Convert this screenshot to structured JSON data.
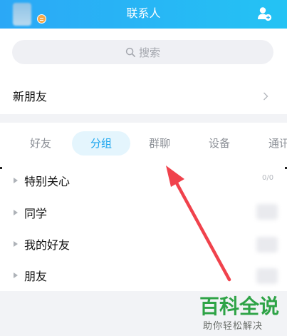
{
  "header": {
    "title": "联系人",
    "add_contact_icon": "add-contact-icon"
  },
  "search": {
    "placeholder": "搜索",
    "icon": "search-icon"
  },
  "new_friend": {
    "label": "新朋友",
    "icon": "chevron-right-icon"
  },
  "tabs": [
    {
      "label": "好友",
      "active": false
    },
    {
      "label": "分组",
      "active": true
    },
    {
      "label": "群聊",
      "active": false
    },
    {
      "label": "设备",
      "active": false
    },
    {
      "label": "通讯",
      "active": false
    }
  ],
  "groups": [
    {
      "label": "特别关心",
      "count": "0/0"
    },
    {
      "label": "同学",
      "count": ""
    },
    {
      "label": "我的好友",
      "count": ""
    },
    {
      "label": "朋友",
      "count": ""
    }
  ],
  "watermark": {
    "main": "百科全说",
    "sub": "助你轻松解决"
  },
  "colors": {
    "header_start": "#2ba8f6",
    "header_end": "#24c3f4",
    "accent": "#1ea6ee",
    "tab_active_bg": "#e4f5fd",
    "annotation_arrow": "#f0424c",
    "watermark": "#2ea346"
  }
}
